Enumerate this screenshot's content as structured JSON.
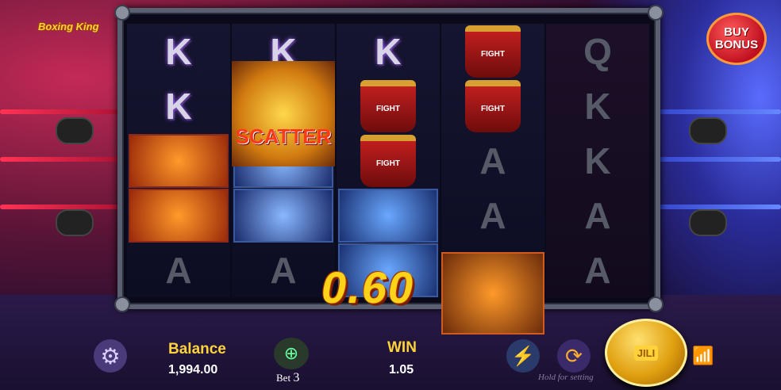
{
  "game": {
    "logo": "Boxing King"
  },
  "buy_bonus": {
    "line1": "BUY",
    "line2": "BONUS"
  },
  "reels": [
    [
      "K",
      "K",
      "glove",
      "glove",
      "A"
    ],
    [
      "K",
      "scatter",
      "lightning",
      "lightning",
      "A"
    ],
    [
      "K",
      "shorts",
      "shorts",
      "fist",
      "fist"
    ],
    [
      "shorts",
      "shorts",
      "A",
      "A",
      "boxer"
    ],
    [
      "Q",
      "K",
      "K",
      "A",
      "A"
    ]
  ],
  "scatter_label": "SCATTER",
  "shorts_label": "FIGHT",
  "win_popup": "0.60",
  "footer": {
    "balance_label": "Balance",
    "balance_value": "1,994.00",
    "bet_label": "Bet",
    "bet_value": "3",
    "win_label": "WIN",
    "win_value": "1.05",
    "hold_hint": "Hold for setting",
    "spin_label": "JILI"
  },
  "icons": {
    "settings": "gear-icon",
    "bet": "chips-icon",
    "turbo": "lightning-icon",
    "autoplay": "autoplay-icon",
    "spin": "spin-icon",
    "signal": "wifi-icon"
  }
}
